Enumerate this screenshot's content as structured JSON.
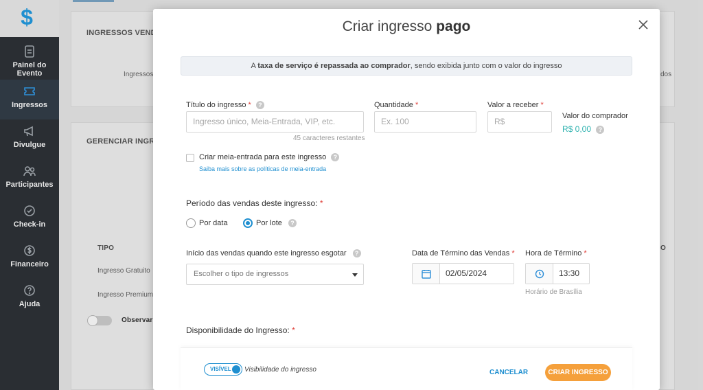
{
  "sidebar": {
    "items": [
      {
        "label": "Painel do Evento",
        "icon": "document-icon"
      },
      {
        "label": "Ingressos",
        "icon": "ticket-icon"
      },
      {
        "label": "Divulgue",
        "icon": "megaphone-icon"
      },
      {
        "label": "Participantes",
        "icon": "users-icon"
      },
      {
        "label": "Check-in",
        "icon": "check-circle-icon"
      },
      {
        "label": "Financeiro",
        "icon": "dollar-icon"
      },
      {
        "label": "Ajuda",
        "icon": "question-icon"
      }
    ]
  },
  "background": {
    "section1_title": "INGRESSOS VENDI",
    "section1_text": "Ingressos",
    "section1_right": "dos",
    "section2_title": "GERENCIAR INGRE",
    "col_tipo": "TIPO",
    "col_right": "O",
    "row1": "Ingresso Gratuito",
    "row2": "Ingresso Premium",
    "toggle_text": "Observar a"
  },
  "modal": {
    "title_prefix": "Criar ingresso ",
    "title_bold": "pago",
    "banner_prefix": "A ",
    "banner_bold": "taxa de serviço é repassada ao comprador",
    "banner_suffix": ", sendo exibida junto com o valor do ingresso",
    "titulo_label": "Título do ingresso",
    "titulo_placeholder": "Ingresso único, Meia-Entrada, VIP, etc.",
    "titulo_hint": "45 caracteres restantes",
    "quantidade_label": "Quantidade",
    "quantidade_placeholder": "Ex. 100",
    "valor_label": "Valor a receber",
    "valor_placeholder": "R$",
    "comprador_label": "Valor do comprador",
    "comprador_value": "R$ 0,00",
    "meia_label": "Criar meia-entrada para este ingresso",
    "meia_link": "Saiba mais sobre as políticas de meia-entrada",
    "periodo_label": "Período das vendas deste ingresso:",
    "por_data": "Por data",
    "por_lote": "Por lote",
    "inicio_label": "Início das vendas quando este ingresso esgotar",
    "inicio_placeholder": "Escolher o tipo de ingressos",
    "data_termino_label": "Data de Término das Vendas",
    "data_termino_value": "02/05/2024",
    "hora_termino_label": "Hora de Término",
    "hora_termino_value": "13:30",
    "horario_hint": "Horário de Brasília",
    "disponibilidade_label": "Disponibilidade do Ingresso:",
    "required_mark": "*",
    "help_mark": "?"
  },
  "footer": {
    "toggle_label": "VISÍVEL",
    "visibility_label": "Visibilidade do ingresso",
    "cancel": "CANCELAR",
    "create": "CRIAR INGRESSO"
  },
  "colors": {
    "accent": "#1f8fd0",
    "create_button": "#f5a03b",
    "money": "#31b3b0",
    "sidebar": "#2a2e33"
  }
}
